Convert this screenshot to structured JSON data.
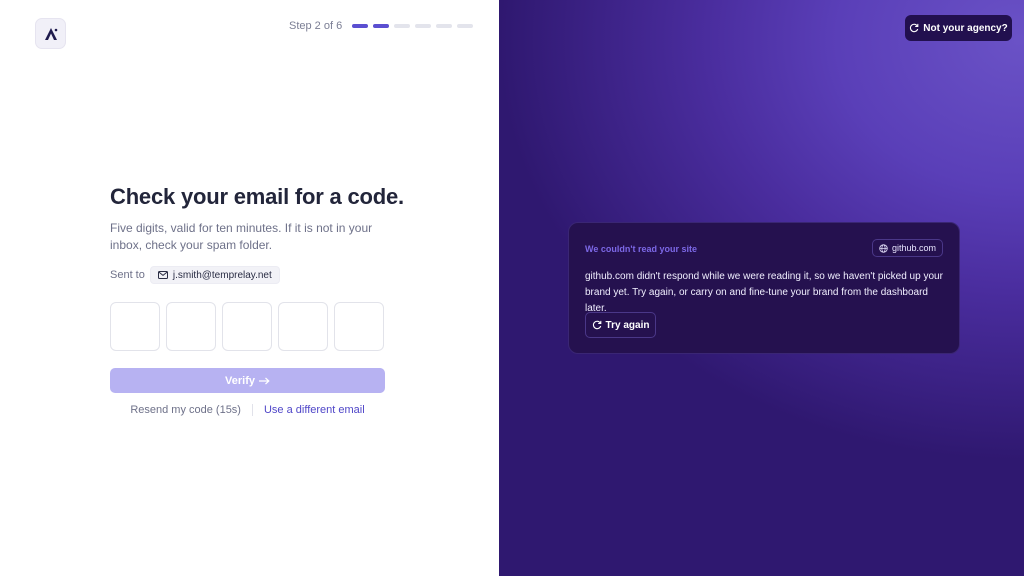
{
  "header": {
    "logo_icon": "arrow-up-logo-icon",
    "step_label": "Step 2 of 6",
    "total_steps": 6,
    "current_step": 2
  },
  "form": {
    "heading": "Check your email for a code.",
    "subtext": "Five digits, valid for ten minutes. If it is not in your inbox, check your spam folder.",
    "sent_label": "Sent to",
    "email": "j.smith@temprelay.net",
    "code_length": 5,
    "verify_label": "Verify",
    "resend_label": "Resend my code (15s)",
    "different_email_label": "Use a different email"
  },
  "panel": {
    "agency_button_label": "Not your agency?",
    "card_title": "We couldn't read your site",
    "site_chip": "github.com",
    "card_body": "github.com didn't respond while we were reading it, so we haven't picked up your brand yet. Try again, or carry on and fine-tune your brand from the dashboard later.",
    "try_again_label": "Try again"
  },
  "colors": {
    "accent": "#5b4fd1",
    "verify_disabled": "#b7b2f2",
    "panel_bg": "#4a2d9e",
    "card_bg": "#25114f"
  }
}
